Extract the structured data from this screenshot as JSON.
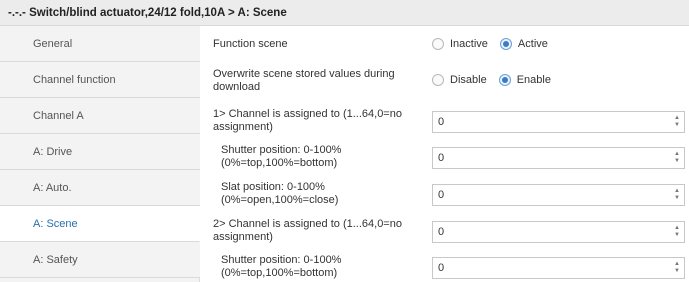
{
  "window": {
    "title": "-.-.- Switch/blind actuator,24/12 fold,10A > A: Scene"
  },
  "sidebar": {
    "items": [
      {
        "label": "General"
      },
      {
        "label": "Channel function"
      },
      {
        "label": "Channel A"
      },
      {
        "label": "A: Drive"
      },
      {
        "label": "A: Auto."
      },
      {
        "label": "A: Scene",
        "active": true
      },
      {
        "label": "A: Safety"
      }
    ]
  },
  "colors": {
    "accent": "#3a7bc8",
    "active_nav_text": "#2a6fb0",
    "sidebar_bg": "#f3f3f3"
  },
  "params": {
    "function_scene": {
      "label": "Function scene",
      "options": [
        "Inactive",
        "Active"
      ],
      "selected": "Active"
    },
    "overwrite_scene": {
      "label": "Overwrite scene stored values during download",
      "options": [
        "Disable",
        "Enable"
      ],
      "selected": "Enable"
    },
    "ch1_assigned": {
      "label": "1> Channel is assigned to (1...64,0=no assignment)",
      "value": "0"
    },
    "ch1_shutter": {
      "label": "Shutter position: 0-100% (0%=top,100%=bottom)",
      "value": "0"
    },
    "ch1_slat": {
      "label": "Slat position: 0-100% (0%=open,100%=close)",
      "value": "0"
    },
    "ch2_assigned": {
      "label": "2> Channel is assigned to (1...64,0=no assignment)",
      "value": "0"
    },
    "ch2_shutter": {
      "label": "Shutter position: 0-100% (0%=top,100%=bottom)",
      "value": "0"
    }
  },
  "icons": {
    "spin_up": "▲",
    "spin_down": "▼"
  }
}
